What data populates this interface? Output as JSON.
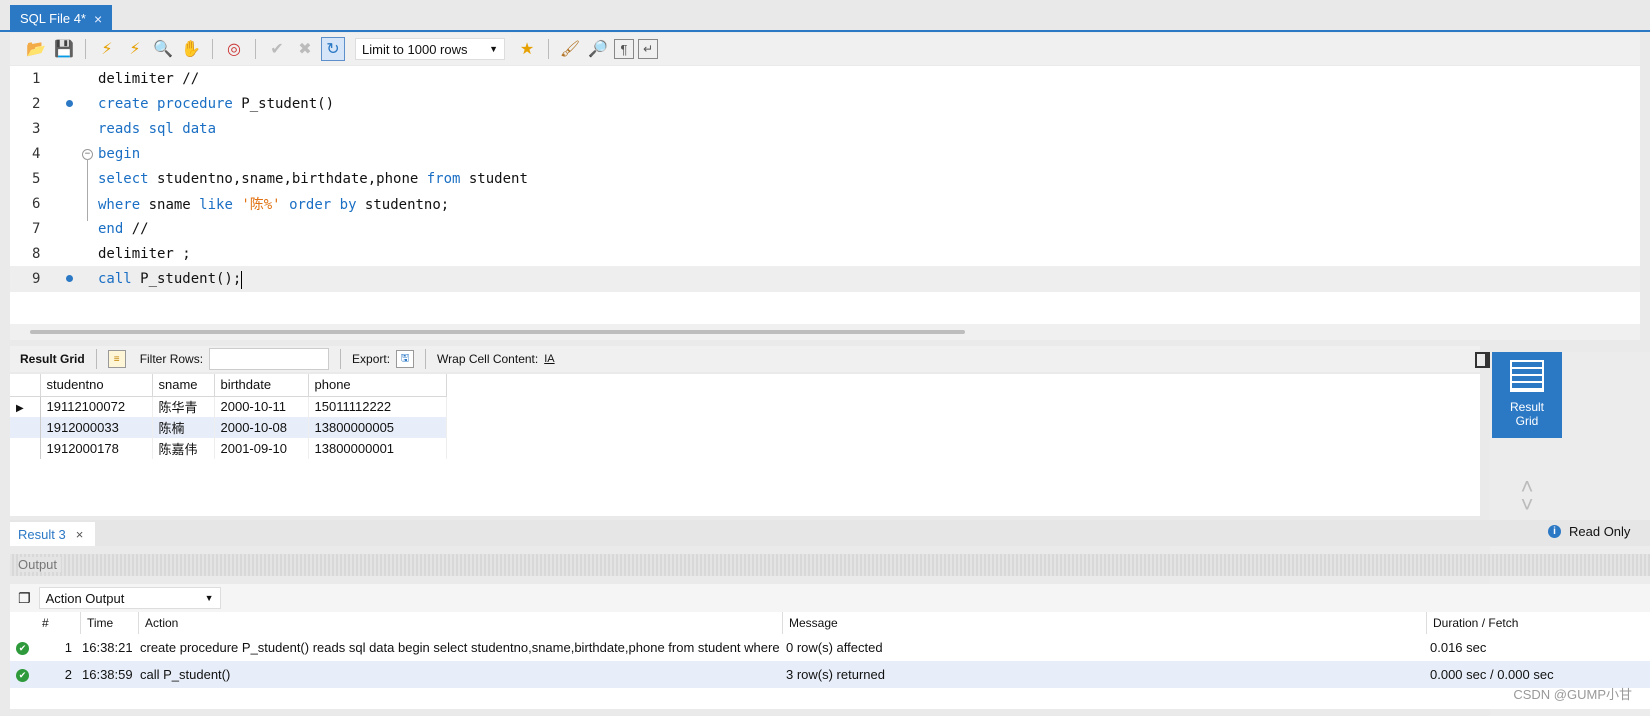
{
  "tab": {
    "title": "SQL File 4*",
    "close": "×"
  },
  "toolbar": {
    "limit_label": "Limit to 1000 rows"
  },
  "editor": {
    "lines": [
      {
        "n": "1",
        "parts": [
          [
            "",
            "delimiter //"
          ]
        ]
      },
      {
        "n": "2",
        "parts": [
          [
            "kw",
            "create procedure"
          ],
          [
            "",
            " P_student()"
          ]
        ]
      },
      {
        "n": "3",
        "parts": [
          [
            "kw",
            "reads sql data"
          ]
        ]
      },
      {
        "n": "4",
        "parts": [
          [
            "kw",
            "begin"
          ]
        ]
      },
      {
        "n": "5",
        "parts": [
          [
            "kw",
            "select"
          ],
          [
            "",
            " studentno,sname,birthdate,phone "
          ],
          [
            "kw",
            "from"
          ],
          [
            "",
            " student"
          ]
        ]
      },
      {
        "n": "6",
        "parts": [
          [
            "kw",
            "where"
          ],
          [
            "",
            " sname "
          ],
          [
            "kw",
            "like"
          ],
          [
            "",
            " "
          ],
          [
            "str",
            "'陈%'"
          ],
          [
            "",
            " "
          ],
          [
            "kw",
            "order by"
          ],
          [
            "",
            " studentno;"
          ]
        ]
      },
      {
        "n": "7",
        "parts": [
          [
            "kw",
            "end"
          ],
          [
            "",
            " //"
          ]
        ]
      },
      {
        "n": "8",
        "parts": [
          [
            "",
            "delimiter ;"
          ]
        ]
      },
      {
        "n": "9",
        "parts": [
          [
            "kw",
            "call"
          ],
          [
            "",
            " P_student();"
          ]
        ]
      }
    ]
  },
  "result_toolbar": {
    "result_grid": "Result Grid",
    "filter_rows": "Filter Rows:",
    "export": "Export:",
    "wrap": "Wrap Cell Content:"
  },
  "grid": {
    "columns": [
      "studentno",
      "sname",
      "birthdate",
      "phone"
    ],
    "rows": [
      [
        "19112100072",
        "陈华青",
        "2000-10-11",
        "15011112222"
      ],
      [
        "1912000033",
        "陈楠",
        "2000-10-08",
        "13800000005"
      ],
      [
        "1912000178",
        "陈嘉伟",
        "2001-09-10",
        "13800000001"
      ]
    ]
  },
  "side": {
    "result_grid_line1": "Result",
    "result_grid_line2": "Grid"
  },
  "result_tab": {
    "label": "Result 3",
    "close": "×"
  },
  "read_only": "Read Only",
  "output": {
    "header": "Output",
    "selector": "Action Output",
    "columns": {
      "num": "#",
      "time": "Time",
      "action": "Action",
      "message": "Message",
      "duration": "Duration / Fetch"
    },
    "rows": [
      {
        "num": "1",
        "time": "16:38:21",
        "action": "create procedure P_student() reads sql data begin select studentno,sname,birthdate,phone from student where ...",
        "message": "0 row(s) affected",
        "duration": "0.016 sec"
      },
      {
        "num": "2",
        "time": "16:38:59",
        "action": "call P_student()",
        "message": "3 row(s) returned",
        "duration": "0.000 sec / 0.000 sec"
      }
    ]
  },
  "watermark": "CSDN @GUMP小甘"
}
